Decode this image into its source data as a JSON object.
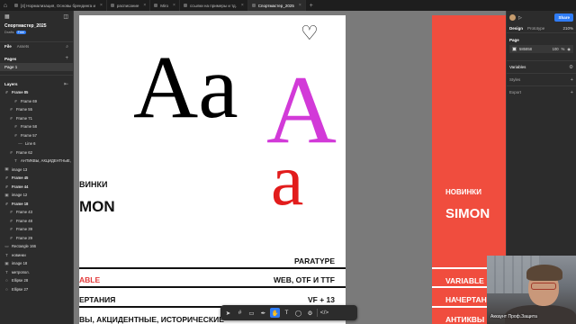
{
  "tabs": [
    {
      "label": "[4] Нормализация, Основы брендинга и",
      "active": false
    },
    {
      "label": "расписание",
      "active": false
    },
    {
      "label": "Miro",
      "active": false
    },
    {
      "label": "ссылки на примеры и тд.",
      "active": false
    },
    {
      "label": "Спортмастер_2025",
      "active": true
    }
  ],
  "left_panel": {
    "file_title": "Спортмастер_2025",
    "file_sub": "Drafts",
    "file_badge": "Free",
    "tab_file": "File",
    "tab_assets": "Assets",
    "pages_header": "Pages",
    "pages": [
      {
        "label": "Page 1",
        "selected": true
      }
    ],
    "layers_header": "Layers",
    "layers": [
      {
        "label": "Frame 85",
        "icon": "#",
        "indent": 0,
        "bold": true
      },
      {
        "label": "Frame 69",
        "icon": "#",
        "indent": 2,
        "bold": false
      },
      {
        "label": "Frame 55",
        "icon": "#",
        "indent": 1,
        "bold": false
      },
      {
        "label": "Frame 71",
        "icon": "#",
        "indent": 1,
        "bold": false
      },
      {
        "label": "Frame 58",
        "icon": "#",
        "indent": 2,
        "bold": false
      },
      {
        "label": "Frame 57",
        "icon": "#",
        "indent": 2,
        "bold": false
      },
      {
        "label": "Line 6",
        "icon": "—",
        "indent": 3,
        "bold": false
      },
      {
        "label": "Frame 62",
        "icon": "#",
        "indent": 1,
        "bold": false
      },
      {
        "label": "АНТИКВЫ, АКЦИДЕНТНЫЕ,",
        "icon": "T",
        "indent": 2,
        "bold": false
      },
      {
        "label": "image 13",
        "icon": "▣",
        "indent": 0,
        "bold": false
      },
      {
        "label": "Frame 45",
        "icon": "#",
        "indent": 0,
        "bold": true
      },
      {
        "label": "Frame 44",
        "icon": "#",
        "indent": 0,
        "bold": true
      },
      {
        "label": "image 12",
        "icon": "▣",
        "indent": 0,
        "bold": false
      },
      {
        "label": "Frame 18",
        "icon": "#",
        "indent": 0,
        "bold": true
      },
      {
        "label": "Frame 43",
        "icon": "#",
        "indent": 1,
        "bold": false
      },
      {
        "label": "Frame 48",
        "icon": "#",
        "indent": 1,
        "bold": false
      },
      {
        "label": "Frame 39",
        "icon": "#",
        "indent": 1,
        "bold": false
      },
      {
        "label": "Frame 29",
        "icon": "#",
        "indent": 1,
        "bold": false
      },
      {
        "label": "Rectangle 166",
        "icon": "▭",
        "indent": 0,
        "bold": false
      },
      {
        "label": "новинки",
        "icon": "T",
        "indent": 0,
        "bold": false
      },
      {
        "label": "image 18",
        "icon": "▣",
        "indent": 0,
        "bold": false
      },
      {
        "label": "метропол.",
        "icon": "T",
        "indent": 0,
        "bold": false
      },
      {
        "label": "Ellipse 28",
        "icon": "○",
        "indent": 0,
        "bold": false
      },
      {
        "label": "Ellipse 27",
        "icon": "○",
        "indent": 0,
        "bold": false
      }
    ]
  },
  "canvas": {
    "big_aa": "Aa",
    "big_A": "A",
    "big_a": "a",
    "heart_icon": "heart-icon",
    "novinki_left": "ВИНКИ",
    "simon_left": "MON",
    "paratype": "PARATYPE",
    "web_formats": "WEB, OTF И TTF",
    "variable_left": "ABLE",
    "vf_count": "VF + 13",
    "styles_left": "ЕРТАНИЯ",
    "antiqua_left": "ВЫ, АКЦИДЕНТНЫЕ, ИСТОРИЧЕСКИЕ",
    "novinki_right": "НОВИНКИ",
    "simon_right": "SIMON",
    "variable_right": "VARIABLE",
    "styles_right": "НАЧЕРТАН",
    "antiqua_right": "АНТИКВЫ"
  },
  "right_panel": {
    "tab_design": "Design",
    "tab_prototype": "Prototype",
    "zoom": "210%",
    "share": "Share",
    "page_label": "Page",
    "page_color_hex": "585858",
    "page_color_opacity": "100",
    "page_color_pct": "%",
    "variables": "Variables",
    "styles": "Styles",
    "export": "Export"
  },
  "webcam": {
    "caption": "Аккаунт Проф.Защита"
  },
  "colors": {
    "accent": "#2f7cf6",
    "canvas_bg": "#7a7a7a",
    "red_frame": "#f04d3e",
    "magenta": "#d23ad8",
    "red_letter": "#e21c1c"
  }
}
